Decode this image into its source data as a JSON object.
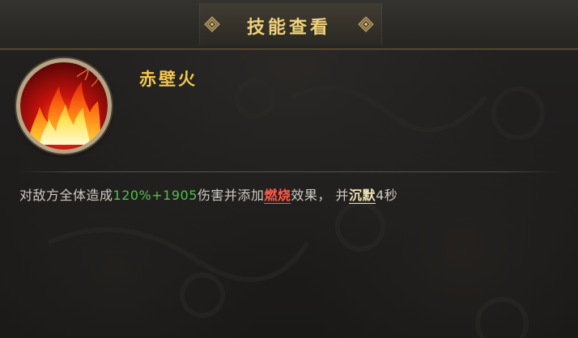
{
  "dialog": {
    "title": "技能查看"
  },
  "skill": {
    "name": "赤壁火",
    "icon": "fire-icon",
    "description": {
      "prefix": "对敌方全体造成",
      "damage_value": "120%+1905",
      "middle": "伤害并添加",
      "burn_keyword": "燃烧",
      "after_burn": "效果，",
      "and": "并",
      "silence_keyword": "沉默",
      "duration": "4秒"
    }
  },
  "colors": {
    "title": "#f0d27a",
    "skill_name": "#f5c84e",
    "damage_value": "#4fc24a",
    "burn_keyword": "#ff5a4a",
    "silence_keyword": "#f1e4b5",
    "text": "#cfcac2"
  }
}
